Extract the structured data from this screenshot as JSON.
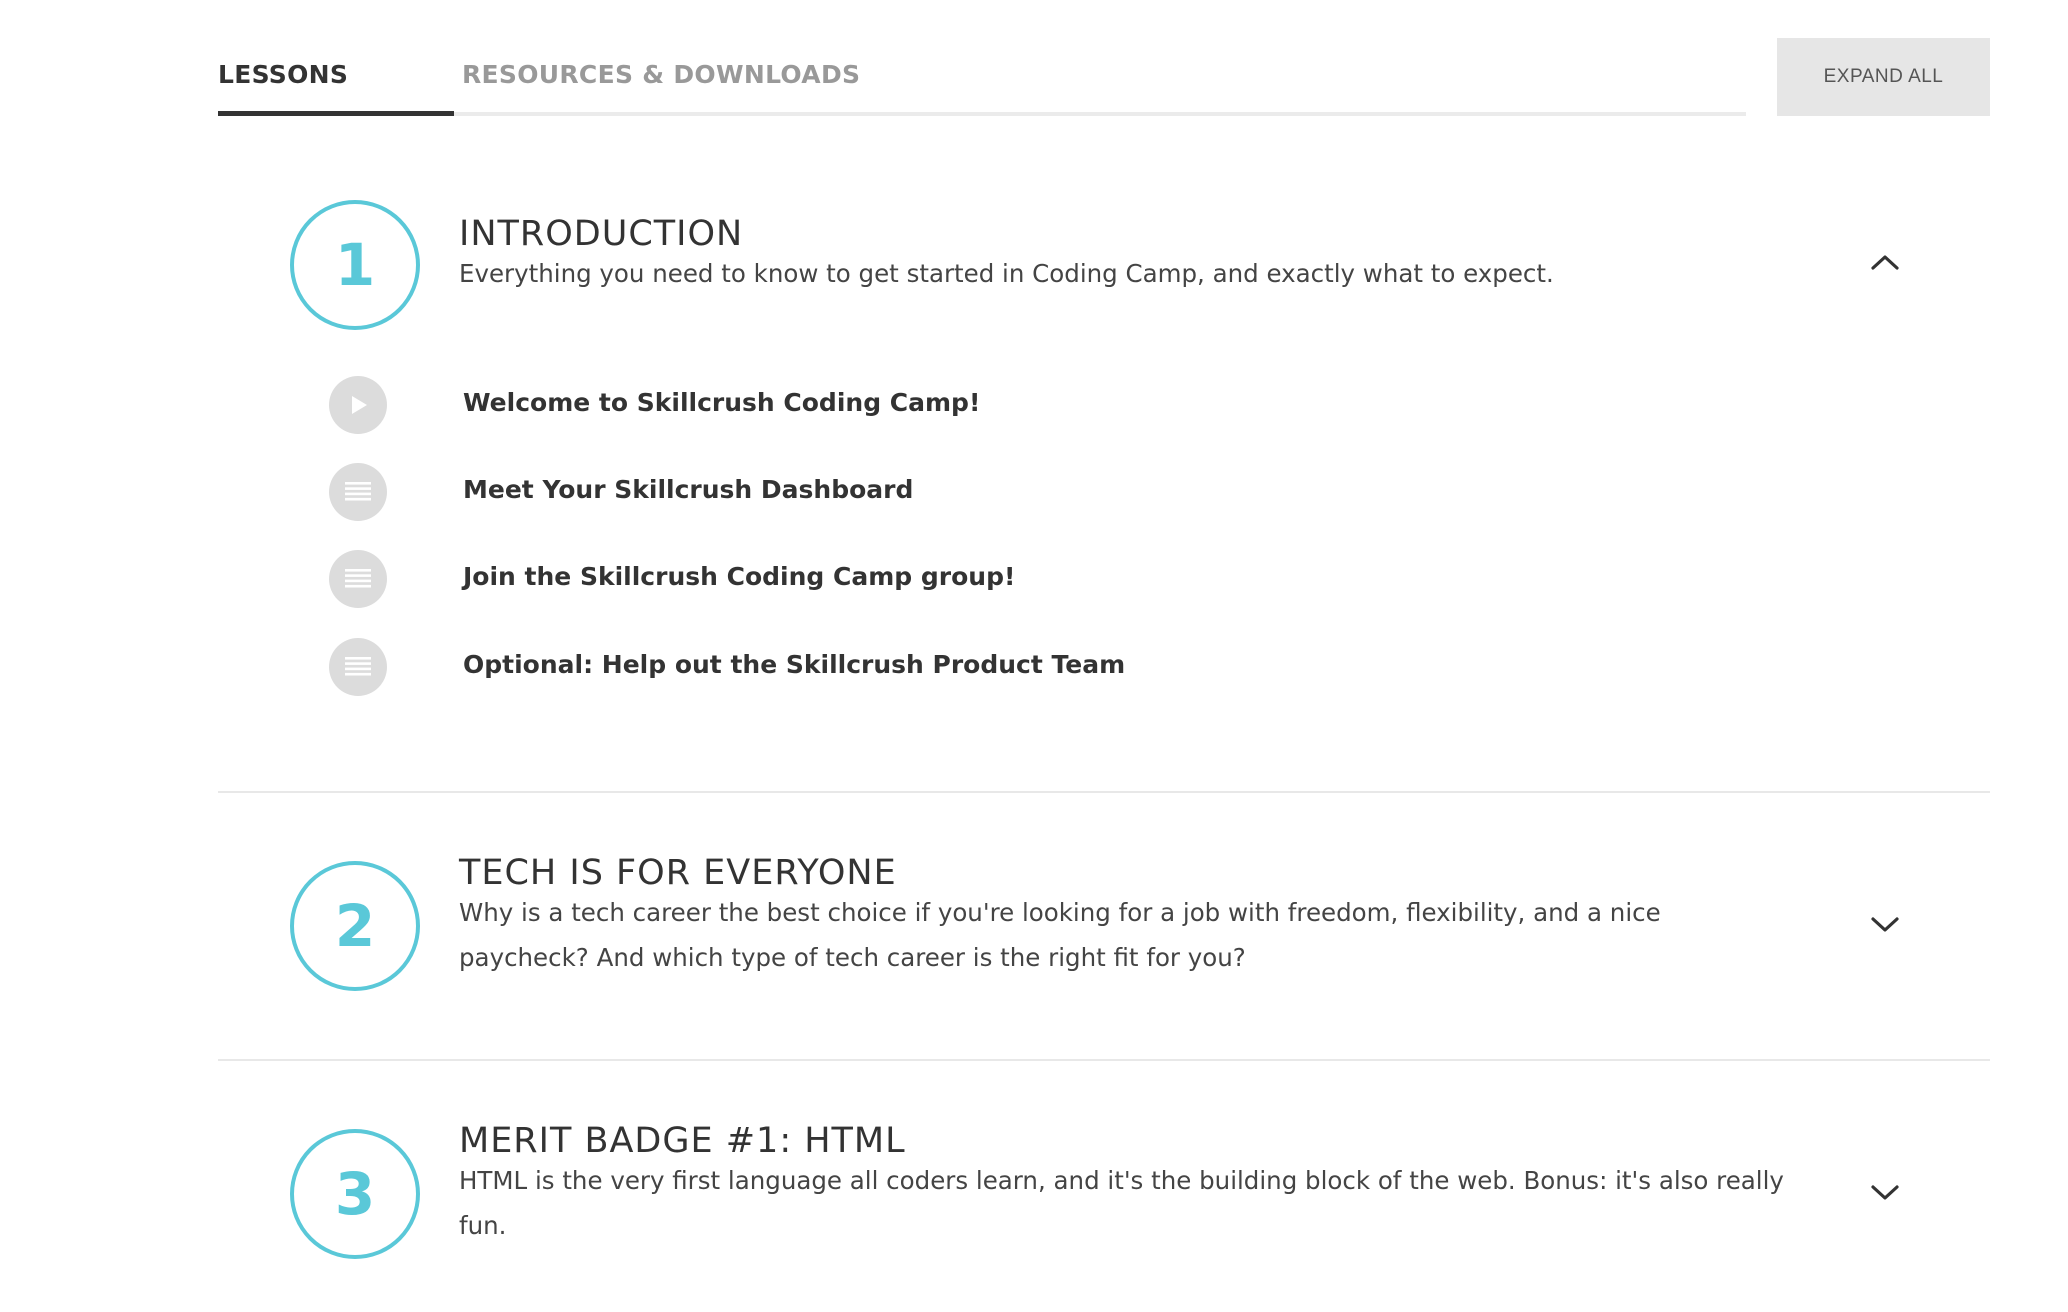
{
  "tabs": {
    "lessons_label": "LESSONS",
    "resources_label": "RESOURCES & DOWNLOADS",
    "active": "lessons"
  },
  "expand_all_label": "EXPAND ALL",
  "colors": {
    "accent": "#5ac8d8",
    "text": "#333333",
    "muted": "#999999",
    "button_bg": "#e6e6e6",
    "icon_bg": "#dcdcdc"
  },
  "modules": [
    {
      "number": "1",
      "title": "INTRODUCTION",
      "description": "Everything you need to know to get started in Coding Camp, and exactly what to expect.",
      "expanded": true,
      "toggle_icon": "chevron-up-icon",
      "lessons": [
        {
          "icon": "play-icon",
          "label": "Welcome to Skillcrush Coding Camp!"
        },
        {
          "icon": "text-lines-icon",
          "label": "Meet Your Skillcrush Dashboard"
        },
        {
          "icon": "text-lines-icon",
          "label": "Join the Skillcrush Coding Camp group!"
        },
        {
          "icon": "text-lines-icon",
          "label": "Optional: Help out the Skillcrush Product Team"
        }
      ]
    },
    {
      "number": "2",
      "title": "TECH IS FOR EVERYONE",
      "description": "Why is a tech career the best choice if you're looking for a job with freedom, flexibility, and a nice paycheck? And which type of tech career is the right fit for you?",
      "expanded": false,
      "toggle_icon": "chevron-down-icon"
    },
    {
      "number": "3",
      "title": "MERIT BADGE #1: HTML",
      "description": "HTML is the very first language all coders learn, and it's the building block of the web. Bonus: it's also really fun.",
      "expanded": false,
      "toggle_icon": "chevron-down-icon"
    }
  ]
}
